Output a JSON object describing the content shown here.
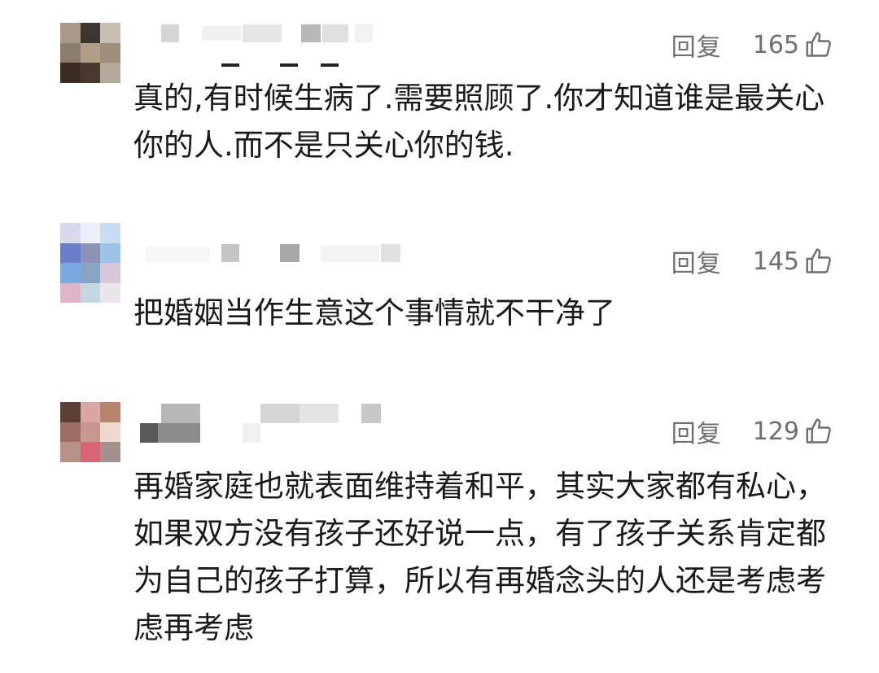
{
  "comments": [
    {
      "reply_label": "回复",
      "likes": "165",
      "text": "真的,有时候生病了.需要照顾了.你才知道谁是最关心你的人.而不是只关心你的钱."
    },
    {
      "reply_label": "回复",
      "likes": "145",
      "text": "把婚姻当作生意这个事情就不干净了"
    },
    {
      "reply_label": "回复",
      "likes": "129",
      "text": "再婚家庭也就表面维持着和平，其实大家都有私心，如果双方没有孩子还好说一点，有了孩子关系肯定都为自己的孩子打算，所以有再婚念头的人还是考虑考虑再考虑"
    }
  ],
  "icons": {
    "like": "thumbs-up-icon"
  },
  "colors": {
    "text": "#1a1a1a",
    "muted": "#6e6e6e",
    "background": "#ffffff"
  }
}
